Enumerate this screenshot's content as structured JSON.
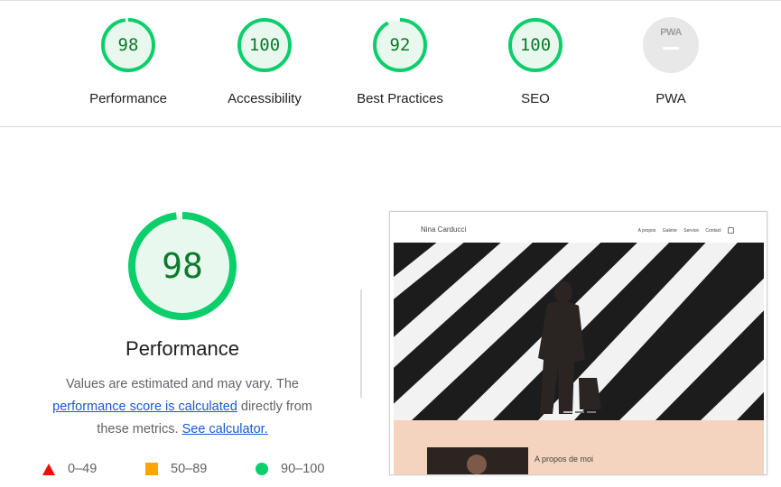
{
  "categories": [
    {
      "label": "Performance",
      "score": "98",
      "value": 98
    },
    {
      "label": "Accessibility",
      "score": "100",
      "value": 100
    },
    {
      "label": "Best Practices",
      "score": "92",
      "value": 92
    },
    {
      "label": "SEO",
      "score": "100",
      "value": 100
    },
    {
      "label": "PWA",
      "badge_text": "PWA"
    }
  ],
  "main": {
    "score": "98",
    "value": 98,
    "title": "Performance",
    "desc_prefix": "Values are estimated and may vary. The ",
    "desc_link": "performance score is calculated",
    "desc_middle": " directly from these metrics.",
    "calc_link": "See calculator."
  },
  "legend": [
    {
      "range": "0–49",
      "shape": "triangle",
      "color": "#eb0f00"
    },
    {
      "range": "50–89",
      "shape": "square",
      "color": "#ffa400"
    },
    {
      "range": "90–100",
      "shape": "circle",
      "color": "#0cce6b"
    }
  ],
  "thumbnail": {
    "site_name": "Nina Carducci",
    "nav": [
      "A propos",
      "Galerie",
      "Service",
      "Contact"
    ],
    "about_title": "A propos de moi"
  },
  "colors": {
    "pass": "#0cce6b",
    "pass_text": "#0c7a2b",
    "pass_fill": "#e9f8ee",
    "link": "#1a57d6"
  }
}
